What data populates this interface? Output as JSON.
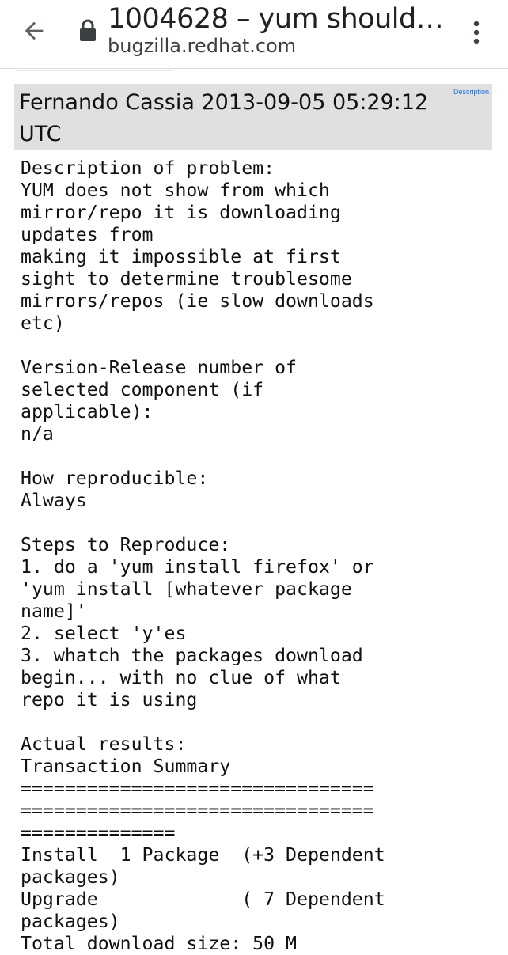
{
  "browser": {
    "title": "1004628 – yum should ...",
    "url": "bugzilla.redhat.com",
    "back_icon": "arrow-back-icon",
    "lock_icon": "lock-icon",
    "menu_icon": "more-vert-icon"
  },
  "comment": {
    "author": "Fernando Cassia",
    "timestamp": "2013-09-05 05:29:12",
    "timezone": "UTC",
    "link_label": "Description",
    "lines": [
      "Description of problem:",
      "YUM does not show from which",
      "mirror/repo it is downloading",
      "updates from",
      "making it impossible at first",
      "sight to determine troublesome",
      "mirrors/repos (ie slow downloads",
      "etc)",
      "",
      "Version-Release number of",
      "selected component (if",
      "applicable):",
      "n/a",
      "",
      "How reproducible:",
      "Always",
      "",
      "Steps to Reproduce:",
      "1. do a 'yum install firefox' or",
      "'yum install [whatever package",
      "name]'",
      "2. select 'y'es",
      "3. whatch the packages download",
      "begin... with no clue of what",
      "repo it is using",
      "",
      "Actual results:",
      "Transaction Summary",
      "================================",
      "================================",
      "==============",
      "Install  1 Package  (+3 Dependent",
      "packages)",
      "Upgrade             ( 7 Dependent",
      "packages)",
      "Total download size: 50 M"
    ]
  },
  "colors": {
    "header_bg": "#e0e0e0",
    "link": "#1a73e8",
    "text": "#111111"
  }
}
